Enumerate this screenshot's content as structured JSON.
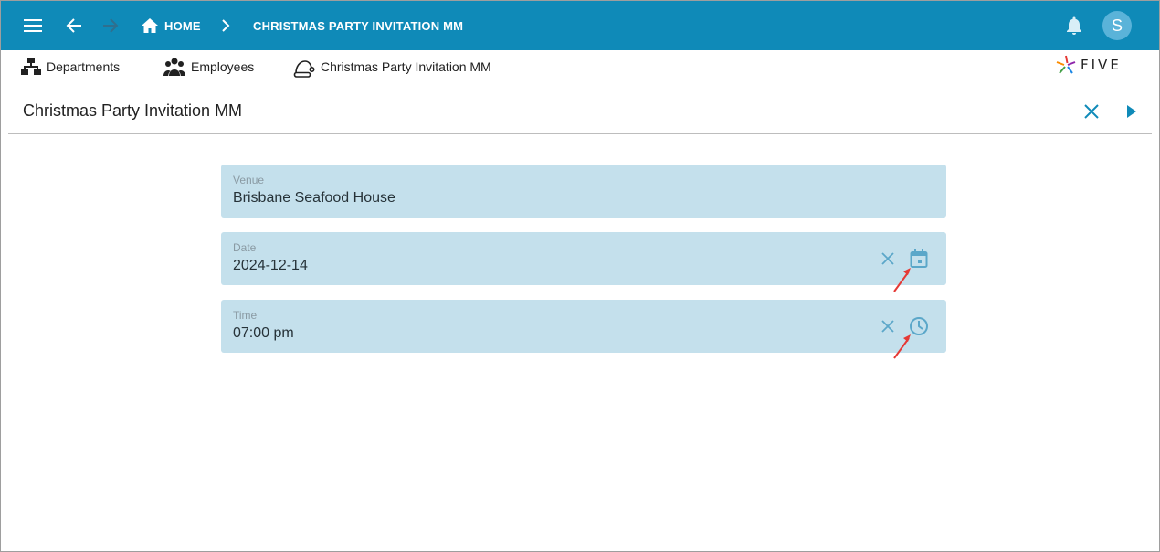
{
  "topbar": {
    "home_label": "HOME",
    "page_label": "CHRISTMAS PARTY INVITATION MM",
    "avatar_letter": "S",
    "color": "#0f8ab8"
  },
  "menu": {
    "items": [
      {
        "label": "Departments",
        "icon": "org-chart-icon"
      },
      {
        "label": "Employees",
        "icon": "people-icon"
      },
      {
        "label": "Christmas Party Invitation MM",
        "icon": "santa-hat-icon"
      }
    ]
  },
  "logo": {
    "text": "FIVE"
  },
  "form": {
    "title": "Christmas Party Invitation MM",
    "fields": [
      {
        "label": "Venue",
        "value": "Brisbane Seafood House"
      },
      {
        "label": "Date",
        "value": "2024-12-14"
      },
      {
        "label": "Time",
        "value": "07:00 pm"
      }
    ]
  },
  "colors": {
    "accent": "#0f8ab8",
    "field_bg": "#c4e0ec",
    "annotation_arrow": "#e53935"
  }
}
